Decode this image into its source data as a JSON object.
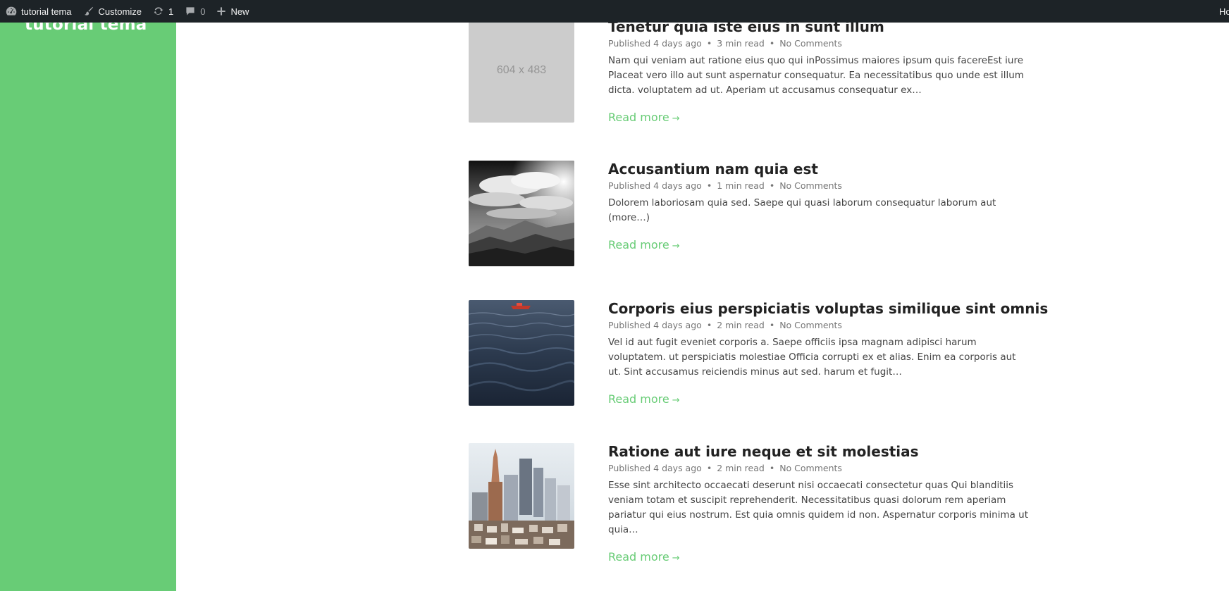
{
  "adminbar": {
    "site_name": "tutorial tema",
    "customize": "Customize",
    "updates_count": "1",
    "comments_count": "0",
    "new_label": "New",
    "right_text": "Ho"
  },
  "sidebar": {
    "site_title": "tutorial tema",
    "bg_color": "#68cc76"
  },
  "posts": [
    {
      "title": "Tenetur quia iste eius in sunt illum",
      "published": "Published 4 days ago",
      "read_time": "3 min read",
      "comments": "No Comments",
      "excerpt": "Nam qui veniam aut ratione eius quo qui inPossimus maiores ipsum quis facereEst iure Placeat vero illo aut sunt aspernatur consequatur. Ea necessitatibus quo unde est illum dicta. voluptatem ad ut. Aperiam ut accusamus consequatur ex…",
      "read_more": "Read more",
      "thumb_label": "604 x 483",
      "thumb_kind": "placeholder"
    },
    {
      "title": "Accusantium nam quia est",
      "published": "Published 4 days ago",
      "read_time": "1 min read",
      "comments": "No Comments",
      "excerpt": "Dolorem laboriosam quia sed. Saepe qui quasi laborum consequatur laborum aut (more…)",
      "read_more": "Read more",
      "thumb_kind": "mountains-bw"
    },
    {
      "title": "Corporis eius perspiciatis voluptas similique sint omnis",
      "published": "Published 4 days ago",
      "read_time": "2 min read",
      "comments": "No Comments",
      "excerpt": "Vel id aut fugit eveniet corporis a. Saepe officiis ipsa magnam adipisci harum voluptatem. ut perspiciatis molestiae Officia corrupti ex et alias. Enim ea corporis aut ut. Sint accusamus reiciendis minus aut sed. harum et fugit…",
      "read_more": "Read more",
      "thumb_kind": "sea-boat"
    },
    {
      "title": "Ratione aut iure neque et sit molestias",
      "published": "Published 4 days ago",
      "read_time": "2 min read",
      "comments": "No Comments",
      "excerpt": "Esse sint architecto occaecati deserunt nisi occaecati consectetur quas Qui blanditiis veniam totam et suscipit reprehenderit. Necessitatibus quasi dolorum rem aperiam pariatur qui eius nostrum. Est quia omnis quidem id non. Aspernatur corporis minima ut quia…",
      "read_more": "Read more",
      "thumb_kind": "city"
    }
  ],
  "colors": {
    "accent": "#68cc76",
    "adminbar": "#1d2327"
  }
}
